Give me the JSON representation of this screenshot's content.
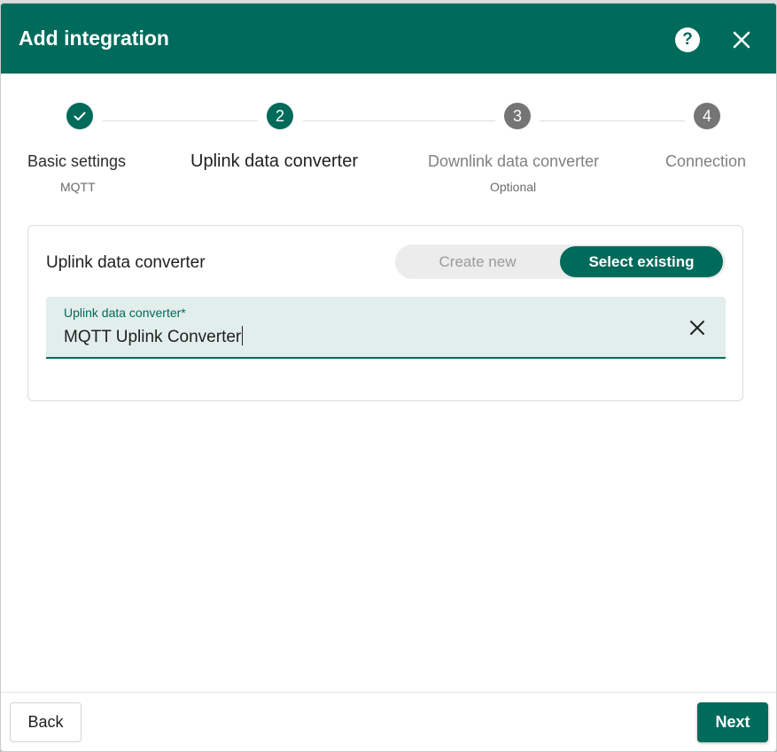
{
  "dialog": {
    "title": "Add integration"
  },
  "stepper": {
    "steps": [
      {
        "number": "",
        "label": "Basic settings",
        "sub": "MQTT",
        "state": "done"
      },
      {
        "number": "2",
        "label": "Uplink data converter",
        "sub": "",
        "state": "active"
      },
      {
        "number": "3",
        "label": "Downlink data converter",
        "sub": "Optional",
        "state": "inactive"
      },
      {
        "number": "4",
        "label": "Connection",
        "sub": "",
        "state": "inactive"
      }
    ]
  },
  "card": {
    "title": "Uplink data converter",
    "toggle": {
      "create_label": "Create new",
      "select_label": "Select existing",
      "selected": "Select existing"
    },
    "field": {
      "label": "Uplink data converter*",
      "value": "MQTT Uplink Converter"
    }
  },
  "footer": {
    "back_label": "Back",
    "next_label": "Next"
  },
  "colors": {
    "primary": "#006a5b",
    "inactive_step": "#757575",
    "field_bg": "#e2eeec"
  },
  "icons": {
    "help": "help-icon",
    "close": "close-icon",
    "check": "check-icon",
    "clear": "clear-icon"
  }
}
